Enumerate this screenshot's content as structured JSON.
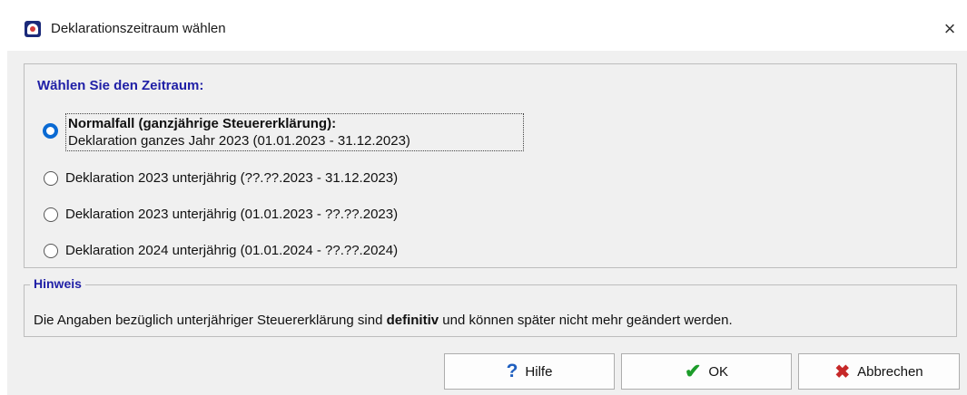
{
  "window": {
    "title": "Deklarationszeitraum wählen",
    "close_symbol": "×"
  },
  "period": {
    "heading": "Wählen Sie den Zeitraum:",
    "options": [
      {
        "title": "Normalfall (ganzjährige Steuererklärung):",
        "label": "Deklaration ganzes Jahr 2023 (01.01.2023 - 31.12.2023)",
        "selected": true
      },
      {
        "label": "Deklaration 2023 unterjährig (??.??.2023 - 31.12.2023)",
        "selected": false
      },
      {
        "label": "Deklaration 2023 unterjährig (01.01.2023 - ??.??.2023)",
        "selected": false
      },
      {
        "label": "Deklaration 2024 unterjährig (01.01.2024 - ??.??.2024)",
        "selected": false
      }
    ]
  },
  "hint": {
    "legend": "Hinweis",
    "text_before": "Die Angaben bezüglich unterjähriger Steuererklärung sind ",
    "text_bold": "definitiv",
    "text_after": " und können später nicht mehr geändert werden."
  },
  "buttons": {
    "help": {
      "label": "Hilfe",
      "icon": "help-icon"
    },
    "ok": {
      "label": "OK",
      "icon": "checkmark-icon"
    },
    "cancel": {
      "label": "Abbrechen",
      "icon": "cross-icon"
    }
  },
  "colors": {
    "heading_blue": "#1f1fa6",
    "radio_selected": "#0a6ad3",
    "check_green": "#1c9c2a",
    "cancel_red": "#c62828"
  }
}
